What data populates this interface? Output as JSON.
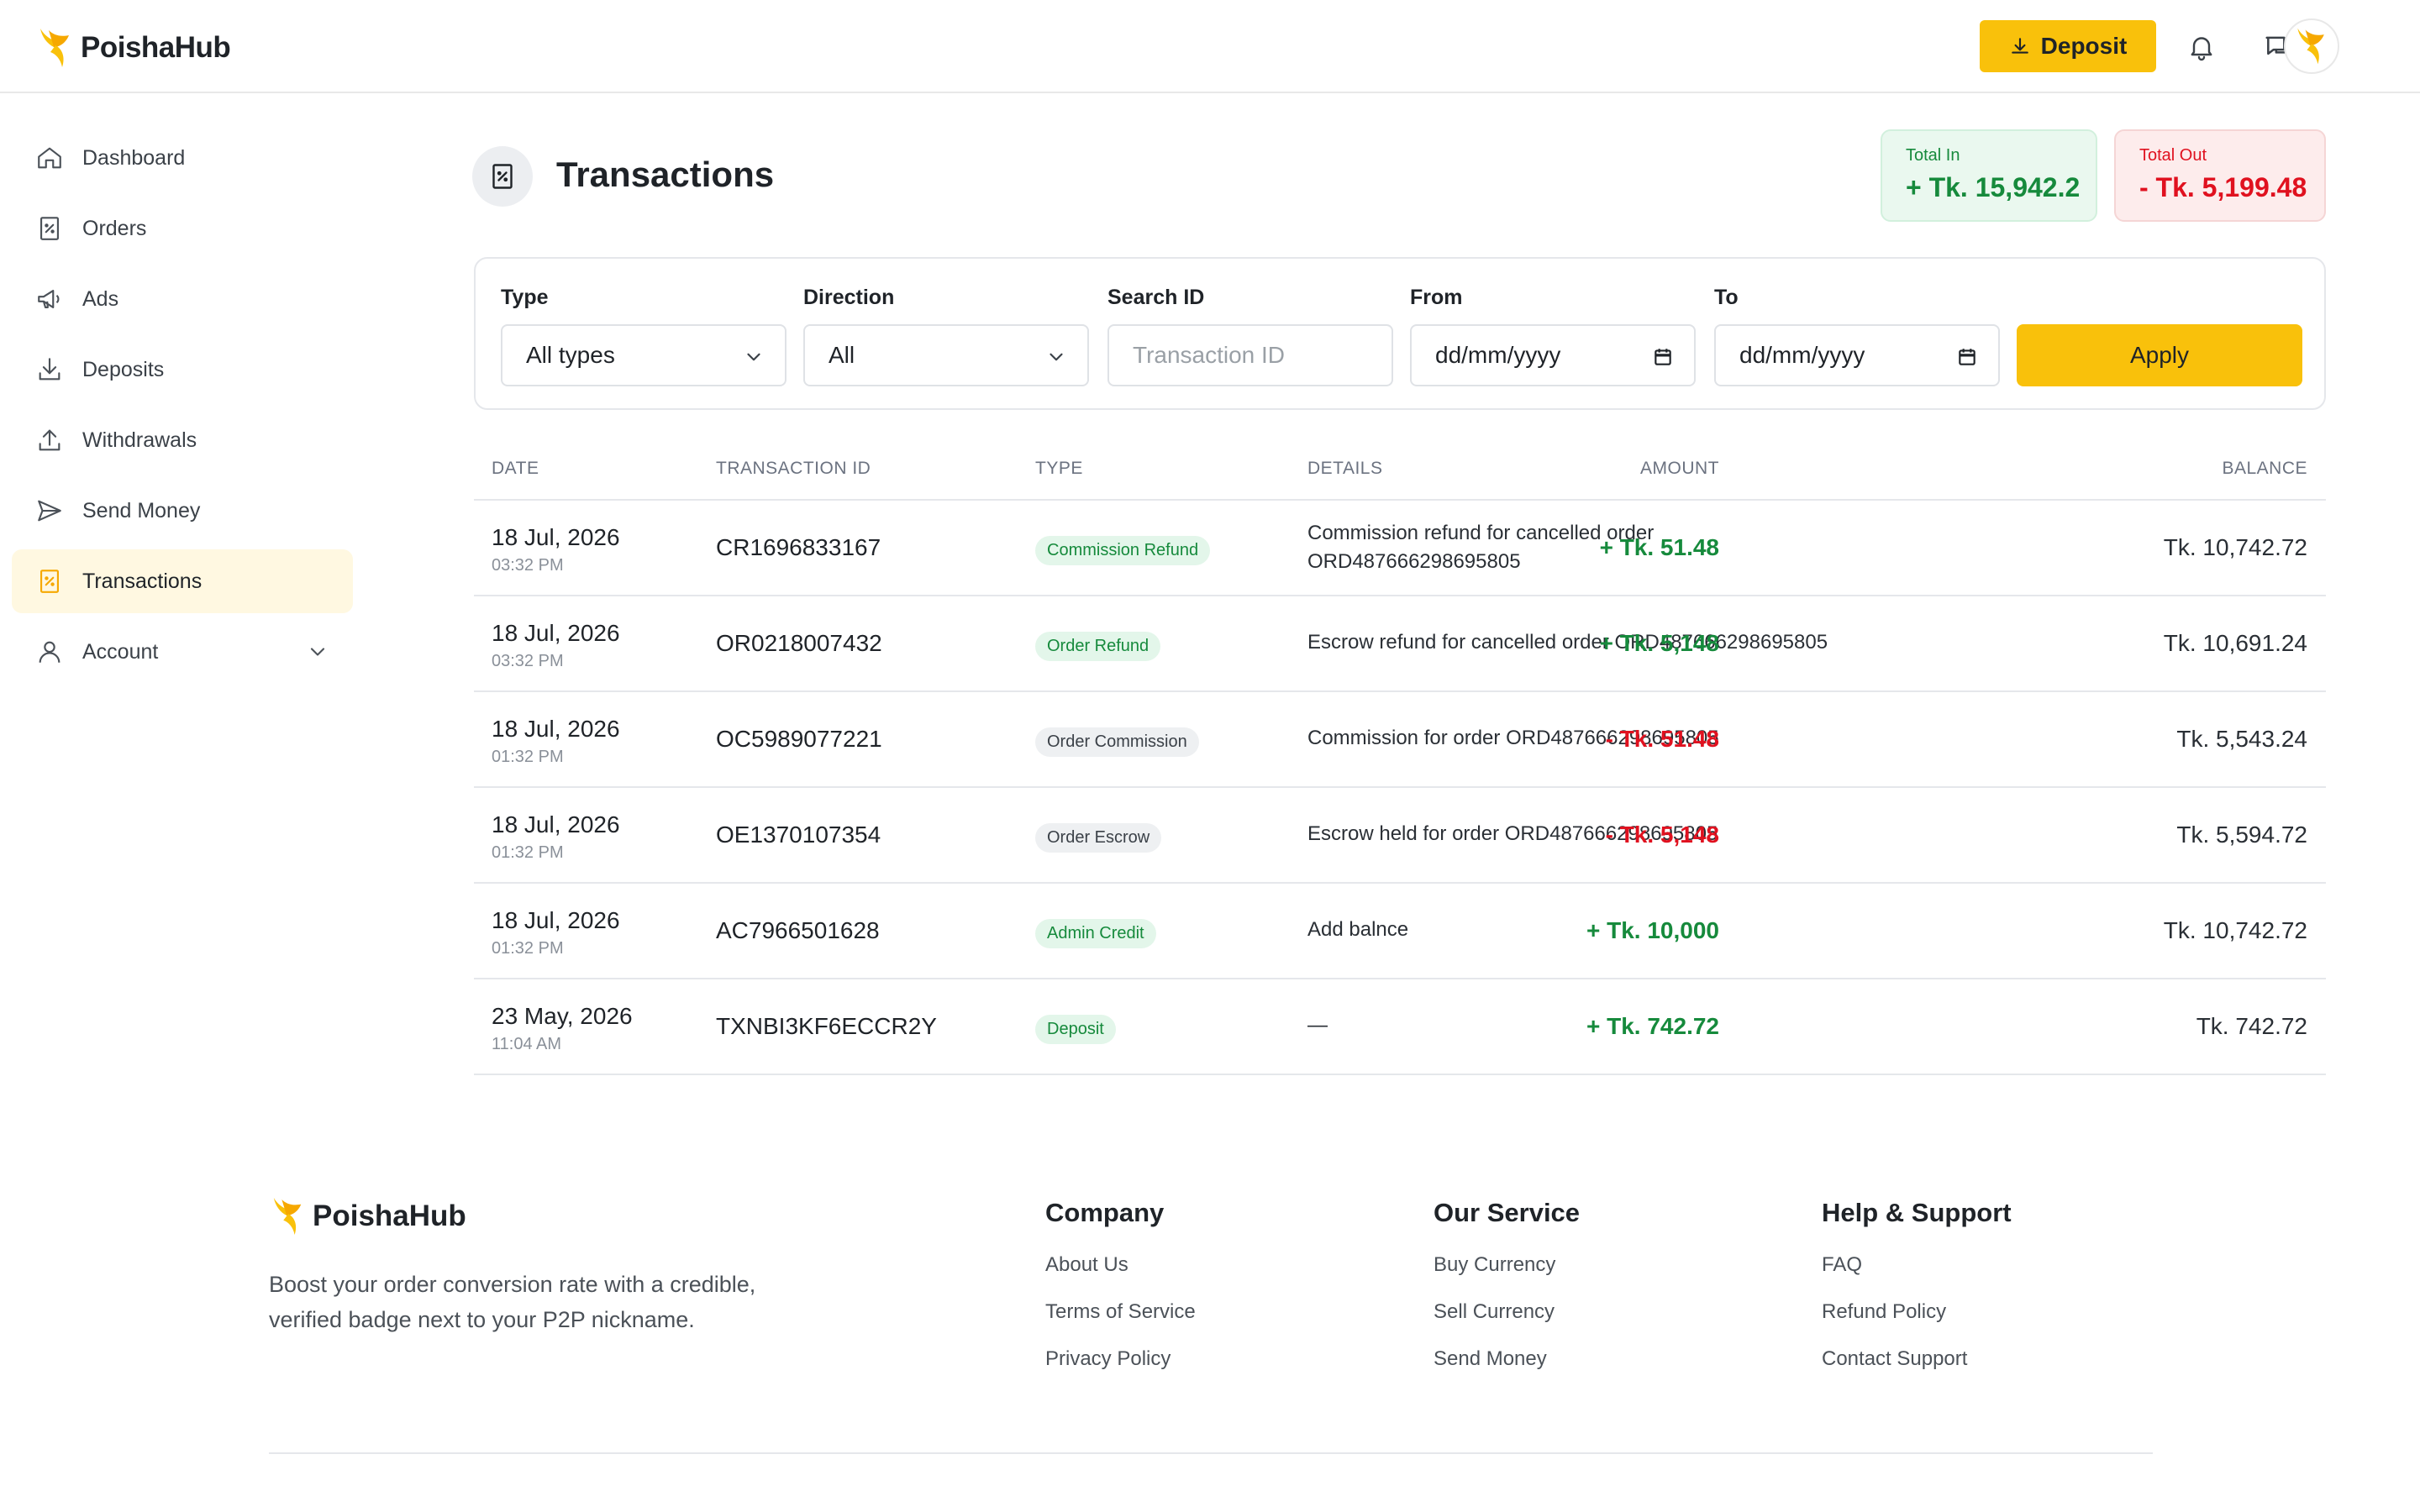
{
  "brand": {
    "name": "PoishaHub",
    "accent": "#f9c10b"
  },
  "header": {
    "deposit_label": "Deposit",
    "icons": [
      "bell-icon",
      "chat-icon",
      "avatar"
    ]
  },
  "sidebar": {
    "items": [
      {
        "label": "Dashboard",
        "icon": "home-icon"
      },
      {
        "label": "Orders",
        "icon": "receipt-icon"
      },
      {
        "label": "Ads",
        "icon": "megaphone-icon"
      },
      {
        "label": "Deposits",
        "icon": "download-icon"
      },
      {
        "label": "Withdrawals",
        "icon": "upload-icon"
      },
      {
        "label": "Send Money",
        "icon": "send-icon"
      },
      {
        "label": "Transactions",
        "icon": "receipt-icon",
        "active": true
      },
      {
        "label": "Account",
        "icon": "user-icon",
        "expandable": true
      }
    ]
  },
  "page": {
    "title": "Transactions",
    "total_in": {
      "label": "Total In",
      "value": "+ Tk. 15,942.2",
      "color": "#168a3c"
    },
    "total_out": {
      "label": "Total Out",
      "value": "- Tk. 5,199.48",
      "color": "#e0111f"
    }
  },
  "filters": {
    "type": {
      "label": "Type",
      "value": "All types"
    },
    "direction": {
      "label": "Direction",
      "value": "All"
    },
    "search": {
      "label": "Search ID",
      "placeholder": "Transaction ID"
    },
    "from": {
      "label": "From",
      "value": "dd/mm/yyyy"
    },
    "to": {
      "label": "To",
      "value": "dd/mm/yyyy"
    },
    "apply_label": "Apply"
  },
  "table": {
    "headers": {
      "date": "DATE",
      "txid": "TRANSACTION ID",
      "type": "TYPE",
      "details": "DETAILS",
      "amount": "AMOUNT",
      "balance": "BALANCE"
    },
    "rows": [
      {
        "date": "18 Jul, 2026",
        "time": "03:32 PM",
        "txid": "CR1696833167",
        "type": "Commission Refund",
        "type_style": "green",
        "details": "Commission refund for cancelled order ORD487666298695805",
        "amount": "+ Tk. 51.48",
        "direction": "pos",
        "balance": "Tk. 10,742.72"
      },
      {
        "date": "18 Jul, 2026",
        "time": "03:32 PM",
        "txid": "OR0218007432",
        "type": "Order Refund",
        "type_style": "green",
        "details": "Escrow refund for cancelled order ORD487666298695805",
        "amount": "+ Tk. 5,148",
        "direction": "pos",
        "balance": "Tk. 10,691.24"
      },
      {
        "date": "18 Jul, 2026",
        "time": "01:32 PM",
        "txid": "OC5989077221",
        "type": "Order Commission",
        "type_style": "gray",
        "details": "Commission for order ORD487666298695805",
        "amount": "- Tk. 51.48",
        "direction": "neg",
        "balance": "Tk. 5,543.24"
      },
      {
        "date": "18 Jul, 2026",
        "time": "01:32 PM",
        "txid": "OE1370107354",
        "type": "Order Escrow",
        "type_style": "gray",
        "details": "Escrow held for order ORD487666298695805",
        "amount": "- Tk. 5,148",
        "direction": "neg",
        "balance": "Tk. 5,594.72"
      },
      {
        "date": "18 Jul, 2026",
        "time": "01:32 PM",
        "txid": "AC7966501628",
        "type": "Admin Credit",
        "type_style": "green",
        "details": "Add balnce",
        "amount": "+ Tk. 10,000",
        "direction": "pos",
        "balance": "Tk. 10,742.72"
      },
      {
        "date": "23 May, 2026",
        "time": "11:04 AM",
        "txid": "TXNBI3KF6ECCR2Y",
        "type": "Deposit",
        "type_style": "green",
        "details": "—",
        "amount": "+ Tk. 742.72",
        "direction": "pos",
        "balance": "Tk. 742.72"
      }
    ]
  },
  "footer": {
    "description": "Boost your order conversion rate with a credible, verified badge next to your P2P nickname.",
    "columns": [
      {
        "title": "Company",
        "links": [
          "About Us",
          "Terms of Service",
          "Privacy Policy"
        ]
      },
      {
        "title": "Our Service",
        "links": [
          "Buy Currency",
          "Sell Currency",
          "Send Money"
        ]
      },
      {
        "title": "Help & Support",
        "links": [
          "FAQ",
          "Refund Policy",
          "Contact Support"
        ]
      }
    ]
  }
}
